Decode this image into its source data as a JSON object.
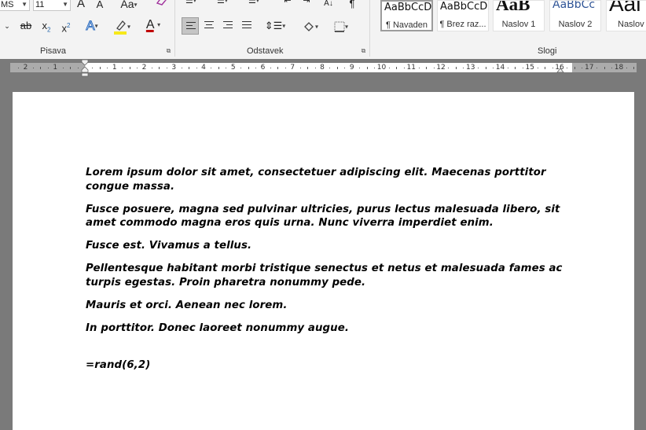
{
  "ribbon": {
    "font_name": "MS",
    "font_size": "11",
    "grow_font": "A",
    "shrink_font": "A",
    "change_case": "Aa",
    "strikethrough": "ab",
    "subscript": "x",
    "subscript_mark": "2",
    "superscript": "x",
    "superscript_mark": "2",
    "text_effects": "A",
    "font_color": "A",
    "highlight_color": "#f7e91b",
    "font_color_value": "#c00000",
    "sort_label": "A↓",
    "pilcrow": "¶",
    "groups": {
      "font": "Pisava",
      "paragraph": "Odstavek",
      "styles": "Slogi"
    },
    "styles": [
      {
        "sample": "AaBbCcD",
        "name": "¶ Navaden"
      },
      {
        "sample": "AaBbCcD",
        "name": "¶ Brez raz..."
      },
      {
        "sample": "AaB",
        "name": "Naslov 1"
      },
      {
        "sample": "AaBbCc",
        "name": "Naslov 2"
      },
      {
        "sample": "Aal",
        "name": "Naslov"
      }
    ]
  },
  "ruler": {
    "labels": [
      "2",
      "1",
      "1",
      "2",
      "3",
      "4",
      "5",
      "6",
      "7",
      "8",
      "9",
      "10",
      "11",
      "12",
      "13",
      "14",
      "15",
      "16",
      "17",
      "18"
    ]
  },
  "document": {
    "paragraphs": [
      "Lorem ipsum dolor sit amet, consectetuer adipiscing elit. Maecenas porttitor congue massa.",
      "Fusce posuere, magna sed pulvinar ultricies, purus lectus malesuada libero, sit amet commodo magna eros quis urna. Nunc viverra imperdiet enim.",
      "Fusce est. Vivamus a tellus.",
      "Pellentesque habitant morbi tristique senectus et netus et malesuada fames ac turpis egestas. Proin pharetra nonummy pede.",
      "Mauris et orci. Aenean nec lorem.",
      "In porttitor. Donec laoreet nonummy augue."
    ],
    "formula": "=rand(6,2)"
  }
}
